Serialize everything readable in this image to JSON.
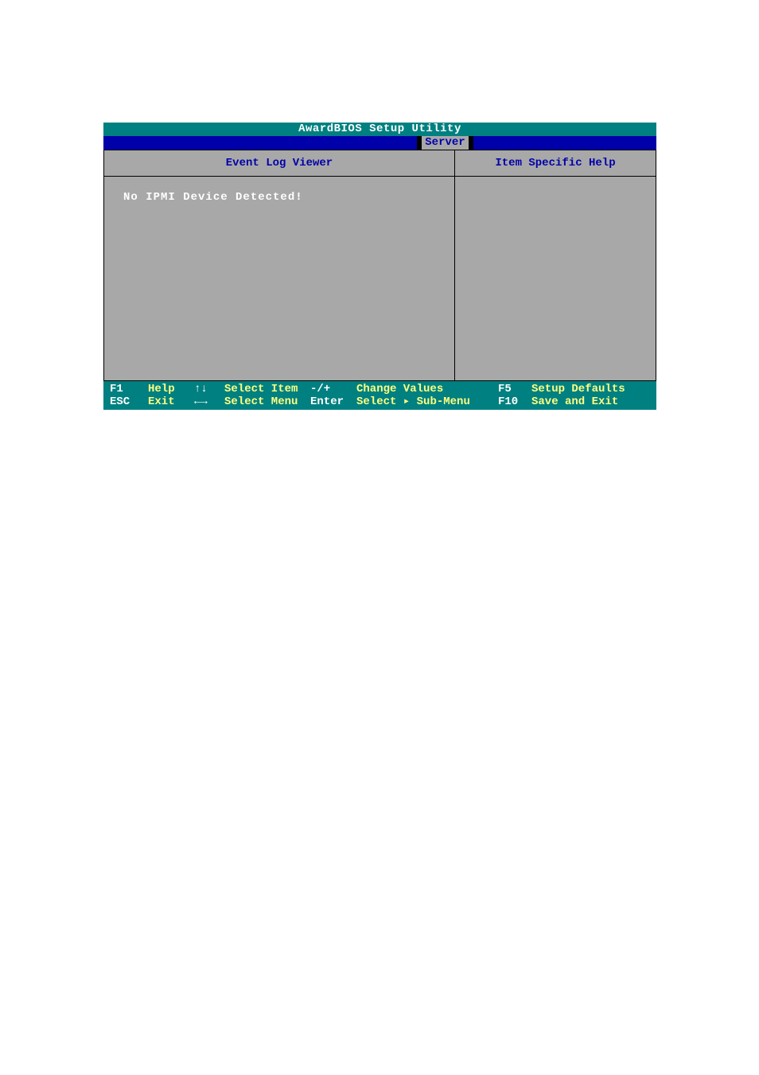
{
  "title": "AwardBIOS Setup Utility",
  "menu_tab": "Server",
  "left_panel": {
    "header": "Event Log Viewer",
    "message": "No IPMI Device Detected!"
  },
  "right_panel": {
    "header": "Item Specific Help"
  },
  "footer": {
    "f1_key": "F1",
    "f1_action": "Help",
    "esc_key": "ESC",
    "esc_action": "Exit",
    "updown_key": "↑↓",
    "updown_action": "Select Item",
    "leftright_key": "←→",
    "leftright_action": "Select Menu",
    "plusminus_key": "-/+",
    "plusminus_action": "Change Values",
    "enter_key": "Enter",
    "enter_action": "Select ▸ Sub-Menu",
    "f5_key": "F5",
    "f5_action": "Setup Defaults",
    "f10_key": "F10",
    "f10_action": "Save and Exit"
  }
}
